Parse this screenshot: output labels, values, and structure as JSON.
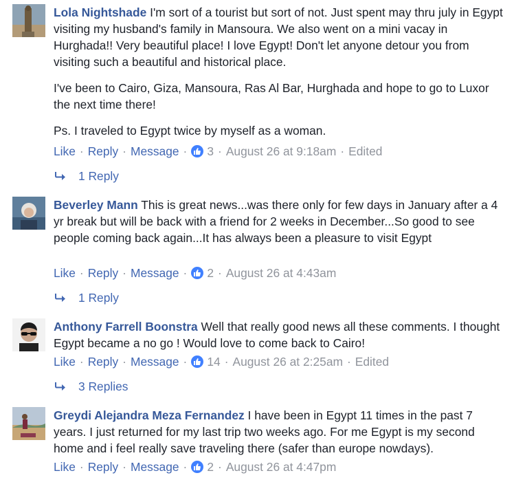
{
  "comments": [
    {
      "author": "Lola Nightshade",
      "avatar": "statue-photo",
      "paragraphs": [
        "I'm sort of a tourist but sort of not. Just spent may thru july in Egypt visiting my husband's family in Mansoura. We also went on a mini vacay in Hurghada!! Very beautiful place! I love Egypt! Don't let anyone detour you from visiting such a beautiful and historical place.",
        "I've been to Cairo, Giza, Mansoura, Ras Al Bar, Hurghada and hope to go to Luxor the next time there!",
        "Ps. I traveled to Egypt twice by myself as a woman."
      ],
      "like_label": "Like",
      "reply_label": "Reply",
      "message_label": "Message",
      "like_count": "3",
      "timestamp": "August 26 at 9:18am",
      "edited": "Edited",
      "replies_label": "1 Reply"
    },
    {
      "author": "Beverley Mann",
      "avatar": "woman-photo",
      "paragraphs": [
        "This is great news...was there only for few days in January after a 4 yr break but will be back with a friend for 2 weeks in December...So good to see people coming back again...It has always been a pleasure to visit Egypt"
      ],
      "like_label": "Like",
      "reply_label": "Reply",
      "message_label": "Message",
      "like_count": "2",
      "timestamp": "August 26 at 4:43am",
      "edited": "",
      "replies_label": "1 Reply"
    },
    {
      "author": "Anthony Farrell Boonstra",
      "avatar": "man-sunglasses-photo",
      "paragraphs": [
        "Well that really good news all these comments. I thought Egypt became a no go ! Would love to come back to Cairo!"
      ],
      "like_label": "Like",
      "reply_label": "Reply",
      "message_label": "Message",
      "like_count": "14",
      "timestamp": "August 26 at 2:25am",
      "edited": "Edited",
      "replies_label": "3 Replies"
    },
    {
      "author": "Greydi Alejandra Meza Fernandez",
      "avatar": "beach-photo",
      "paragraphs": [
        "I have been in Egypt 11 times in the past 7 years. I just returned for my last trip two weeks ago. For me Egypt is my second home and i feel really save traveling there (safer than europe nowdays)."
      ],
      "like_label": "Like",
      "reply_label": "Reply",
      "message_label": "Message",
      "like_count": "2",
      "timestamp": "August 26 at 4:47pm",
      "edited": "",
      "replies_label": ""
    }
  ],
  "colors": {
    "link": "#4267b2",
    "author": "#365899",
    "meta": "#90949c",
    "like_badge": "#4080ff",
    "text": "#1d2129"
  },
  "icons": {
    "like": "thumbs-up-icon",
    "reply_arrow": "reply-arrow-icon"
  },
  "separator": "·"
}
